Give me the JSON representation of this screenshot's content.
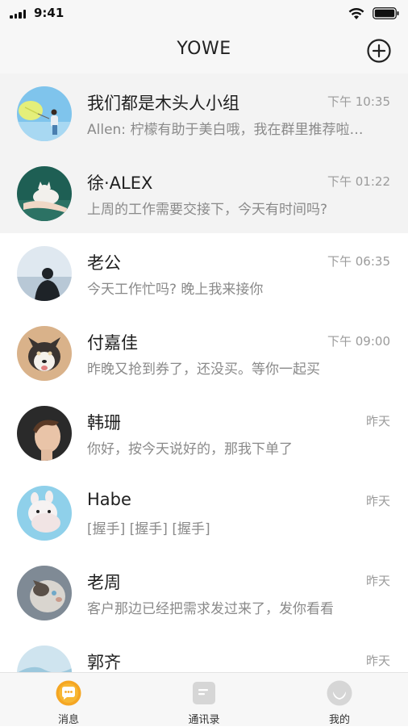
{
  "status_bar": {
    "time": "9:41"
  },
  "header": {
    "title": "YOWE"
  },
  "chats": [
    {
      "name": "我们都是木头人小组",
      "time": "下午 10:35",
      "preview": "Allen: 柠檬有助于美白哦，我在群里推荐啦…",
      "pinned": true
    },
    {
      "name": "徐·ALEX",
      "time": "下午 01:22",
      "preview": "上周的工作需要交接下，今天有时间吗?",
      "pinned": true
    },
    {
      "name": "老公",
      "time": "下午 06:35",
      "preview": "今天工作忙吗? 晚上我来接你",
      "pinned": false
    },
    {
      "name": "付嘉佳",
      "time": "下午 09:00",
      "preview": "昨晚又抢到券了，还没买。等你一起买",
      "pinned": false
    },
    {
      "name": "韩珊",
      "time": "昨天",
      "preview": "你好，按今天说好的，那我下单了",
      "pinned": false
    },
    {
      "name": "Habe",
      "time": "昨天",
      "preview": "[握手] [握手] [握手]",
      "pinned": false
    },
    {
      "name": "老周",
      "time": "昨天",
      "preview": "客户那边已经把需求发过来了，发你看看",
      "pinned": false
    },
    {
      "name": "郭齐",
      "time": "昨天",
      "preview": "",
      "pinned": false
    }
  ],
  "tabs": [
    {
      "label": "消息",
      "icon": "message-icon",
      "active": true
    },
    {
      "label": "通讯录",
      "icon": "contacts-icon",
      "active": false
    },
    {
      "label": "我的",
      "icon": "profile-icon",
      "active": false
    }
  ],
  "colors": {
    "accent": "#f5a623",
    "pinned_bg": "#f3f3f3",
    "muted_text": "#8a8a8a"
  }
}
